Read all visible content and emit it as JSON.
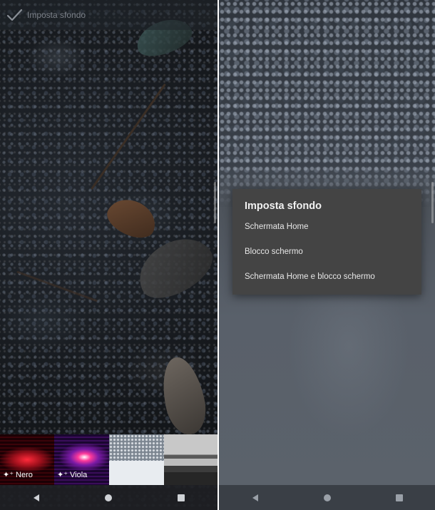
{
  "left": {
    "top_bar": {
      "title": "Imposta sfondo",
      "icon": "check-icon"
    },
    "thumbnails": [
      {
        "label": "Nero",
        "icon": "sparkle-icon"
      },
      {
        "label": "Viola",
        "icon": "sparkle-icon"
      },
      {
        "label": ""
      },
      {
        "label": ""
      }
    ],
    "nav": [
      "back-icon",
      "home-icon",
      "recents-icon"
    ]
  },
  "right": {
    "dialog": {
      "title": "Imposta sfondo",
      "options": [
        "Schermata Home",
        "Blocco schermo",
        "Schermata Home e blocco schermo"
      ]
    },
    "nav": [
      "back-icon",
      "home-icon",
      "recents-icon"
    ]
  },
  "colors": {
    "dialog_bg": "#444444",
    "dialog_text": "#f1f1f1",
    "nav_icon": "#cfd2d6"
  }
}
